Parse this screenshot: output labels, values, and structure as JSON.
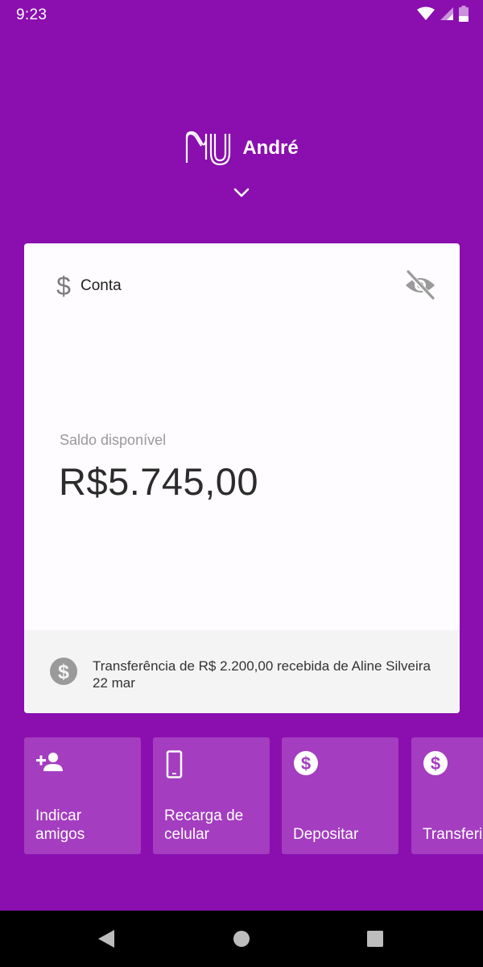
{
  "status_bar": {
    "time": "9:23",
    "icons": [
      "wifi-icon",
      "signal-icon",
      "battery-icon"
    ]
  },
  "header": {
    "logo": "nu-logo",
    "user_name": "André",
    "expand_icon": "chevron-down-icon"
  },
  "account_card": {
    "icon": "dollar-icon",
    "title": "Conta",
    "visibility_icon": "eye-off-icon",
    "balance_label": "Saldo disponível",
    "balance_value": "R$5.745,00",
    "last_transaction": {
      "icon": "dollar-circle-icon",
      "text": "Transferência de R$ 2.200,00 recebida de Aline Silveira",
      "date": "22 mar"
    }
  },
  "shortcuts": [
    {
      "icon": "add-person-icon",
      "label": "Indicar\namigos"
    },
    {
      "icon": "phone-icon",
      "label": "Recarga de\ncelular"
    },
    {
      "icon": "dollar-circle-icon",
      "label": "Depositar"
    },
    {
      "icon": "dollar-circle-icon",
      "label": "Transferir"
    }
  ],
  "nav_bar": {
    "buttons": [
      "back-icon",
      "home-icon",
      "recents-icon"
    ]
  },
  "colors": {
    "brand_purple": "#8a0fae",
    "shortcut_bg": "#a43dc0",
    "card_bg": "#fefcfe",
    "card_footer_bg": "#f4f4f4"
  }
}
